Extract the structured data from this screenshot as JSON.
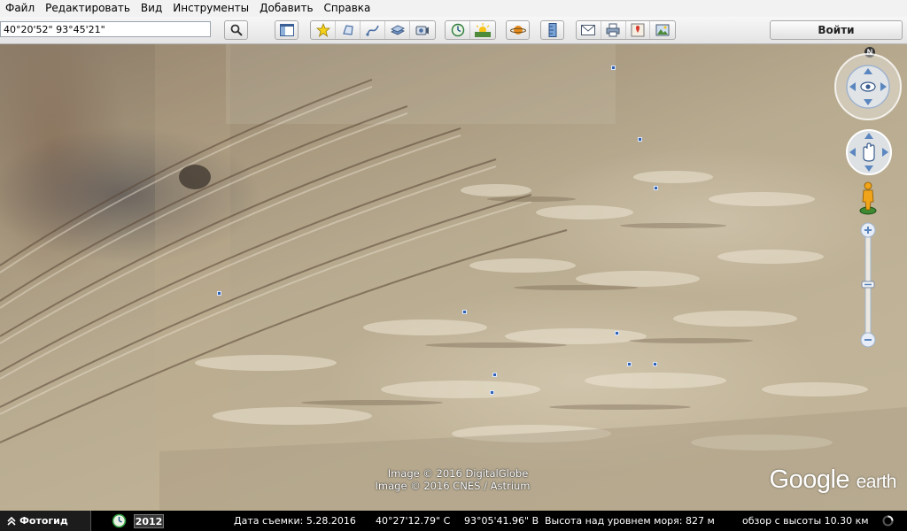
{
  "menu": {
    "items": [
      "Файл",
      "Редактировать",
      "Вид",
      "Инструменты",
      "Добавить",
      "Справка"
    ]
  },
  "toolbar": {
    "search_value": "40°20'52\" 93°45'21\"",
    "signin_label": "Войти"
  },
  "map": {
    "attribution": [
      "Image © 2016 DigitalGlobe",
      "Image © 2016 CNES / Astrium"
    ],
    "logo_google": "Google",
    "logo_earth": "earth",
    "north_label": "N"
  },
  "statusbar": {
    "photo_tour": "Фотогид",
    "history_year": "2012",
    "capture_date": "Дата съемки: 5.28.2016",
    "latitude": "40°27'12.79\" С",
    "longitude": "93°05'41.96\" В",
    "elevation": "Высота над уровнем моря:  827 м",
    "eye_altitude": "обзор с высоты  10.30 км"
  },
  "colors": {
    "statusbar_bg": "#000000",
    "marker": "#2e62b3",
    "toolbar_bg": "#ececec"
  }
}
